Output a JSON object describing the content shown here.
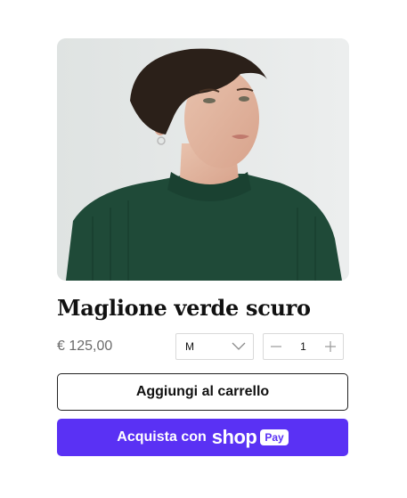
{
  "product": {
    "image_alt": "product-photo",
    "title": "Maglione verde scuro",
    "price": "€ 125,00"
  },
  "size_select": {
    "value": "M"
  },
  "quantity": {
    "value": "1"
  },
  "buttons": {
    "add_to_cart": "Aggiungi al carrello",
    "buy_prefix": "Acquista con",
    "shop_logo": "shop",
    "pay_badge": "Pay"
  },
  "colors": {
    "shop_pay": "#5a31f4",
    "sweater_green": "#1f4a38"
  }
}
